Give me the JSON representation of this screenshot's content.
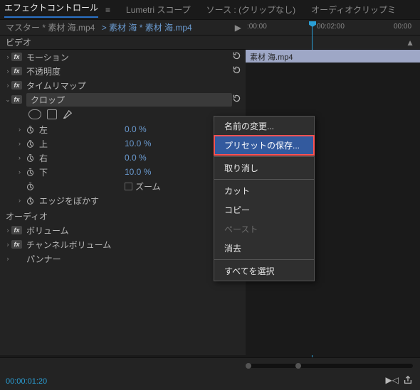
{
  "tabs": {
    "effect_controls": "エフェクトコントロール",
    "lumetri": "Lumetri スコープ",
    "source": "ソース : (クリップなし)",
    "audio_clip": "オーディオクリップミ"
  },
  "header": {
    "master_prefix": "マスター * 素材 海.mp4",
    "instance": "素材 海 * 素材 海.mp4"
  },
  "timeline": {
    "t0": ":00:00",
    "t1": "00:02:00",
    "t2": "00:00",
    "clip_label": "素材 海.mp4"
  },
  "sections": {
    "video": "ビデオ",
    "audio": "オーディオ"
  },
  "effects": {
    "motion": "モーション",
    "opacity": "不透明度",
    "time_remap": "タイムリマップ",
    "crop": "クロップ",
    "volume": "ボリューム",
    "channel_volume": "チャンネルボリューム",
    "panner": "パンナー"
  },
  "crop_params": {
    "left_label": "左",
    "left_value": "0.0 %",
    "top_label": "上",
    "top_value": "10.0 %",
    "right_label": "右",
    "right_value": "0.0 %",
    "bottom_label": "下",
    "bottom_value": "10.0 %",
    "zoom_label": "ズーム",
    "edge_blur_label": "エッジをぼかす"
  },
  "context_menu": {
    "rename": "名前の変更...",
    "save_preset": "プリセットの保存...",
    "undo": "取り消し",
    "cut": "カット",
    "copy": "コピー",
    "paste": "ペースト",
    "clear": "消去",
    "select_all": "すべてを選択"
  },
  "footer": {
    "timestamp": "00:00:01:20"
  }
}
